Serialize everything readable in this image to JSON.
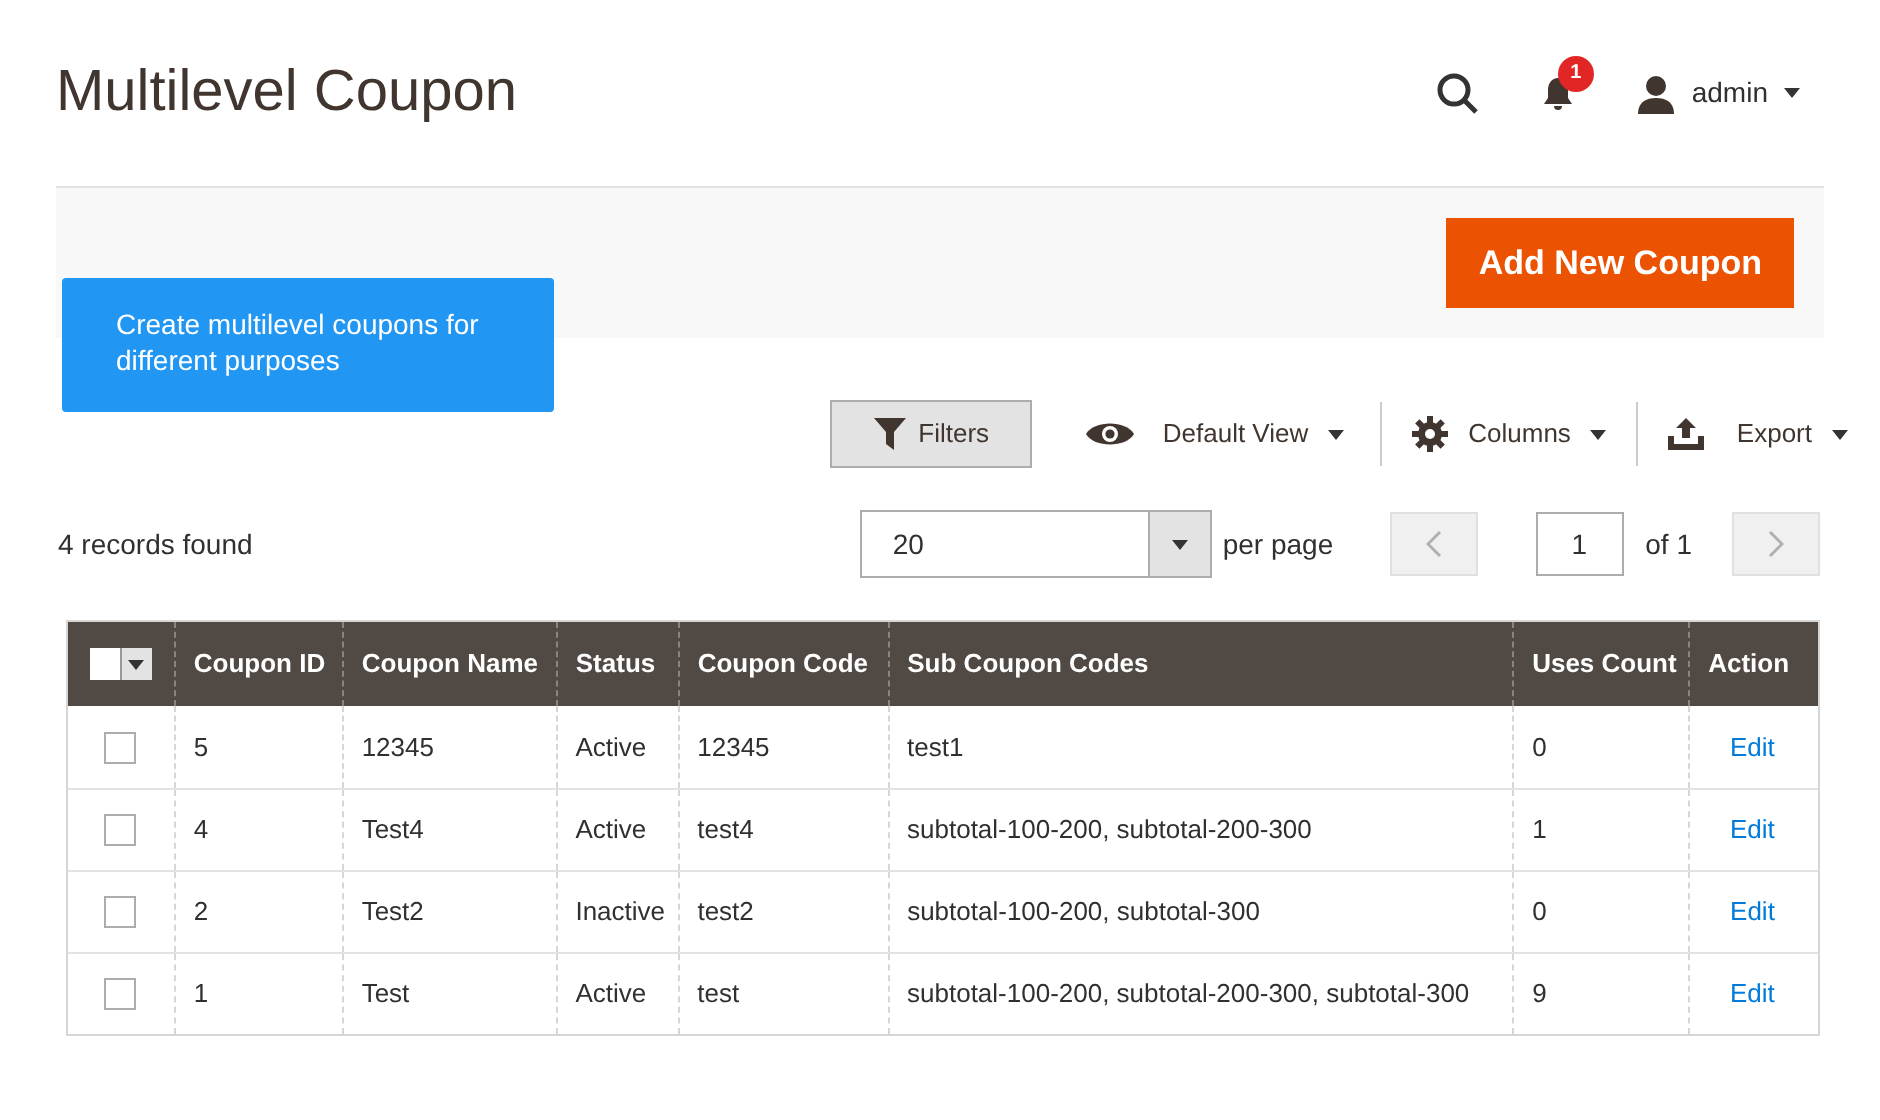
{
  "page_title": "Multilevel Coupon",
  "header": {
    "notification_count": "1",
    "user": "admin"
  },
  "add_button": "Add New Coupon",
  "callout": "Create multilevel coupons for different purposes",
  "toolbar": {
    "filters": "Filters",
    "view": "Default View",
    "columns": "Columns",
    "export": "Export"
  },
  "records_found": "4 records found",
  "pager": {
    "per_page_value": "20",
    "per_page_label": "per page",
    "page": "1",
    "of": "of 1"
  },
  "table": {
    "select_all_checked": false,
    "columns": [
      "Coupon ID",
      "Coupon Name",
      "Status",
      "Coupon Code",
      "Sub Coupon Codes",
      "Uses Count",
      "Action"
    ],
    "rows": [
      {
        "checked": false,
        "cells": [
          "5",
          "12345",
          "Active",
          "12345",
          "test1",
          "0"
        ],
        "action": "Edit"
      },
      {
        "checked": false,
        "cells": [
          "4",
          "Test4",
          "Active",
          "test4",
          "subtotal-100-200, subtotal-200-300",
          "1"
        ],
        "action": "Edit"
      },
      {
        "checked": false,
        "cells": [
          "2",
          "Test2",
          "Inactive",
          "test2",
          "subtotal-100-200, subtotal-300",
          "0"
        ],
        "action": "Edit"
      },
      {
        "checked": false,
        "cells": [
          "1",
          "Test",
          "Active",
          "test",
          "subtotal-100-200, subtotal-200-300, subtotal-300",
          "9"
        ],
        "action": "Edit"
      }
    ]
  }
}
